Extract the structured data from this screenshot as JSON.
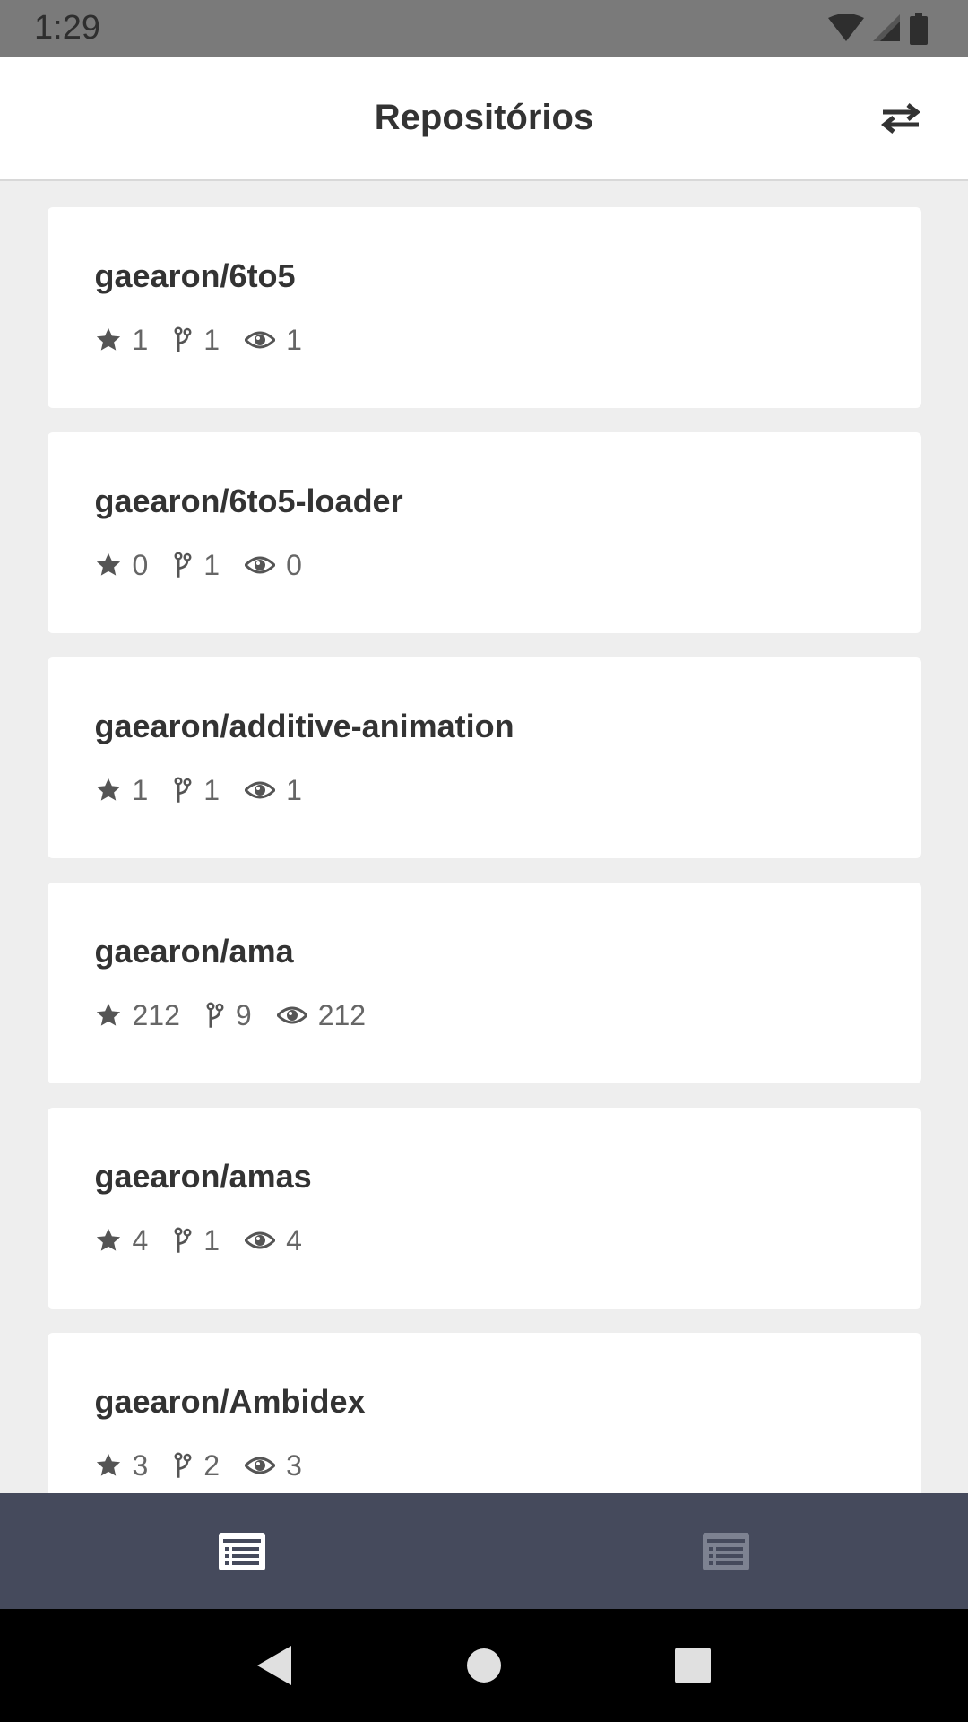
{
  "status_bar": {
    "time": "1:29",
    "icons": [
      "wifi-icon",
      "signal-icon",
      "battery-icon"
    ]
  },
  "app_bar": {
    "title": "Repositórios",
    "action_icon": "swap-icon"
  },
  "repositories": [
    {
      "name": "gaearon/6to5",
      "stars": "1",
      "forks": "1",
      "watchers": "1"
    },
    {
      "name": "gaearon/6to5-loader",
      "stars": "0",
      "forks": "1",
      "watchers": "0"
    },
    {
      "name": "gaearon/additive-animation",
      "stars": "1",
      "forks": "1",
      "watchers": "1"
    },
    {
      "name": "gaearon/ama",
      "stars": "212",
      "forks": "9",
      "watchers": "212"
    },
    {
      "name": "gaearon/amas",
      "stars": "4",
      "forks": "1",
      "watchers": "4"
    },
    {
      "name": "gaearon/Ambidex",
      "stars": "3",
      "forks": "2",
      "watchers": "3"
    }
  ],
  "bottom_nav": {
    "items": [
      {
        "icon": "list-icon",
        "active": true
      },
      {
        "icon": "list-icon",
        "active": false
      }
    ]
  },
  "colors": {
    "status_bar": "#7a7a7a",
    "app_bar": "#ffffff",
    "background": "#eeeeee",
    "card": "#ffffff",
    "bottom_nav": "#454a5c",
    "active_icon": "#ffffff",
    "inactive_icon": "#7d8291"
  }
}
